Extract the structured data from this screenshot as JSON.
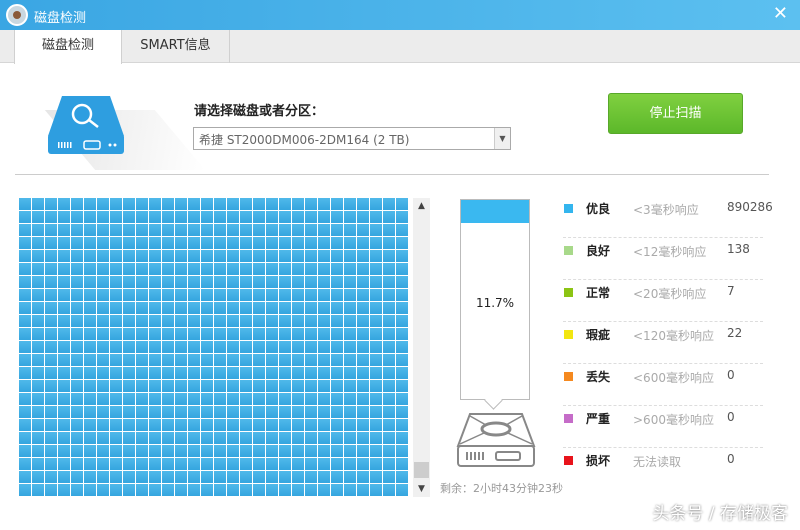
{
  "window": {
    "title": "磁盘检测",
    "close": "✕"
  },
  "tabs": [
    {
      "label": "磁盘检测",
      "active": true
    },
    {
      "label": "SMART信息",
      "active": false
    }
  ],
  "disk_select": {
    "label": "请选择磁盘或者分区：",
    "value": "希捷 ST2000DM006-2DM164  (2 TB)"
  },
  "stop_button": "停止扫描",
  "scan": {
    "progress_percent": 11.7,
    "progress_text": "11.7%",
    "remaining": "剩余：2小时43分钟23秒",
    "block_count": 690
  },
  "legend": [
    {
      "name": "优良",
      "desc": "<3毫秒响应",
      "count": "890286",
      "color": "#33b5ee"
    },
    {
      "name": "良好",
      "desc": "<12毫秒响应",
      "count": "138",
      "color": "#a8d98a"
    },
    {
      "name": "正常",
      "desc": "<20毫秒响应",
      "count": "7",
      "color": "#8cc414"
    },
    {
      "name": "瑕疵",
      "desc": "<120毫秒响应",
      "count": "22",
      "color": "#f2e611"
    },
    {
      "name": "丢失",
      "desc": "<600毫秒响应",
      "count": "0",
      "color": "#f5891f"
    },
    {
      "name": "严重",
      "desc": ">600毫秒响应",
      "count": "0",
      "color": "#c56cc8"
    },
    {
      "name": "损坏",
      "desc": "无法读取",
      "count": "0",
      "color": "#e8131b"
    }
  ],
  "watermark": "头条号 / 存储极客"
}
